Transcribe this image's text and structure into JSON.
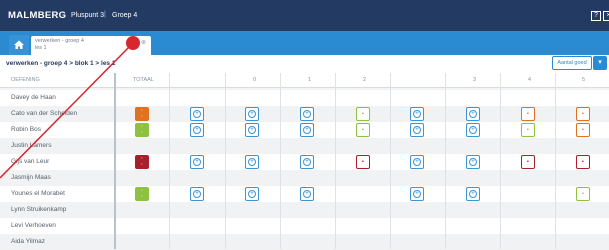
{
  "header": {
    "logo": "MALMBERG",
    "course": "Pluspunt 3",
    "separator": "|",
    "group": "Groep 4",
    "icons": [
      "help-icon",
      "close-icon"
    ]
  },
  "tab": {
    "line1": "verwerken - groep 4",
    "line2": "les 1"
  },
  "breadcrumb": "verwerken - groep 4 > blok 1 > les 1",
  "toolbar": {
    "aantal_label": "Aantal goed",
    "dropdown": "▾"
  },
  "table": {
    "col_oefening": "OEFENING",
    "col_totaal": "TOTAAL",
    "cols": [
      "",
      "0",
      "1",
      "2",
      "3",
      "4",
      "5"
    ],
    "rows": [
      {
        "name": "Davey de Haan"
      },
      {
        "name": "Cato van der Schelden"
      },
      {
        "name": "Robin Bos"
      },
      {
        "name": "Justin Lamers"
      },
      {
        "name": "Gijs van Leur"
      },
      {
        "name": "Jasmijn Maas"
      },
      {
        "name": "Younes el Morabet"
      },
      {
        "name": "Lynn Struikenkamp"
      },
      {
        "name": "Levi Verhoeven"
      },
      {
        "name": "Aida Yilmaz"
      }
    ]
  },
  "colors": {
    "topbar": "#233a63",
    "accent": "#2a8ad2",
    "score_orange": "#e07120",
    "score_green": "#8cc23f",
    "score_red": "#a8202c"
  }
}
